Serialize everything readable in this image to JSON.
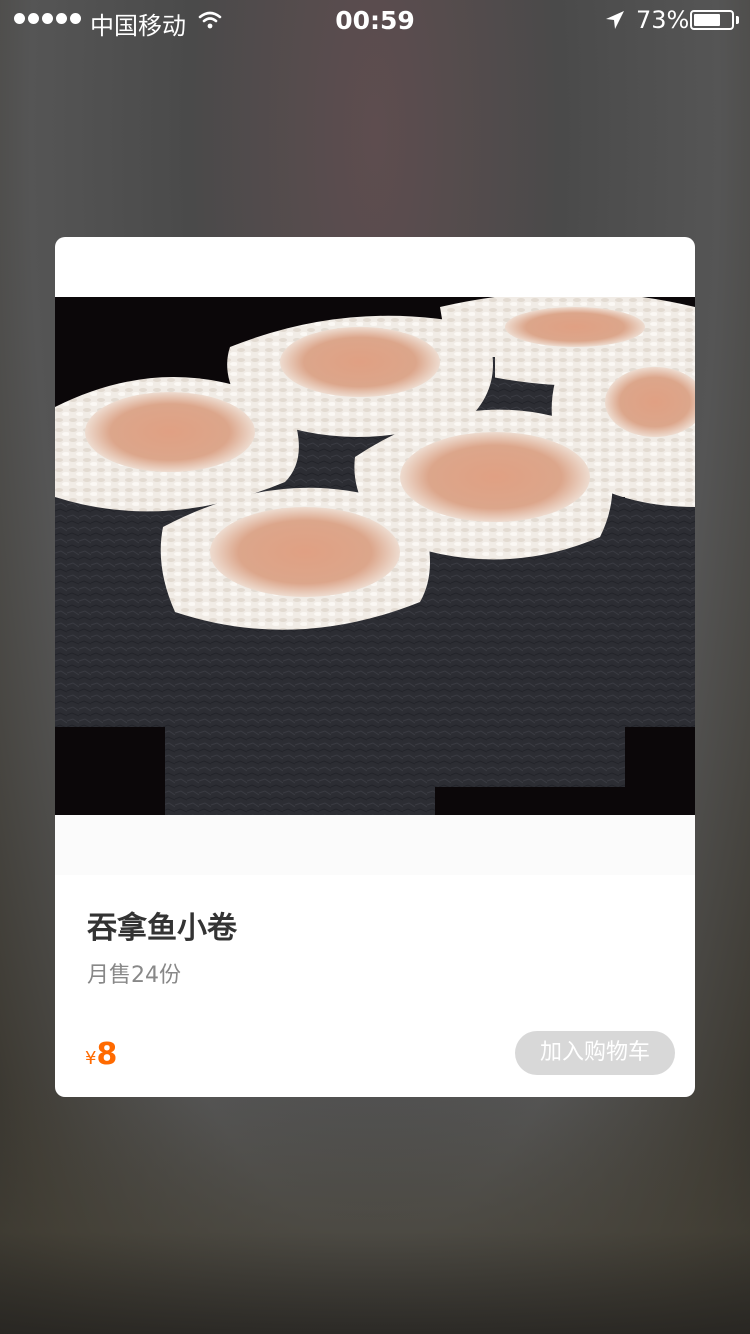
{
  "status_bar": {
    "carrier": "中国移动",
    "time": "00:59",
    "battery_percent_text": "73%",
    "battery_level": 0.73,
    "icons": [
      "signal-dots-icon",
      "wifi-icon",
      "location-arrow-icon",
      "battery-icon"
    ]
  },
  "product": {
    "name": "吞拿鱼小卷",
    "sales": "月售24份",
    "currency": "¥",
    "price": "8",
    "add_to_cart_label": "加入购物车",
    "image": "tuna-sushi-rolls-photo"
  },
  "colors": {
    "price": "#ff6a00",
    "button_disabled": "#d8d8d8"
  }
}
